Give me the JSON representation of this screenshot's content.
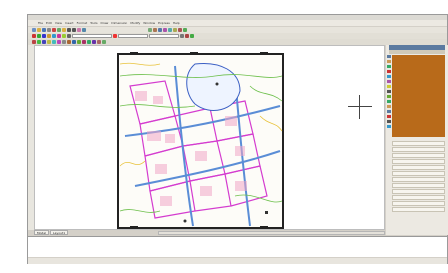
{
  "menu": {
    "items": [
      "File",
      "Edit",
      "View",
      "Insert",
      "Format",
      "Tools",
      "Draw",
      "Dimension",
      "Modify",
      "Window",
      "Express",
      "Help"
    ]
  },
  "status_panel": {
    "title": "",
    "header": "",
    "rows": [
      "",
      "",
      "",
      "",
      "",
      "",
      "",
      "",
      ""
    ]
  },
  "layer_list": [
    "",
    "",
    "",
    "",
    "",
    "",
    "",
    "",
    "",
    "",
    "",
    ""
  ],
  "tabs": [
    "Model",
    "Layout1"
  ],
  "command_lines": [
    "",
    "",
    ""
  ],
  "status_items": [
    "",
    "",
    "",
    "",
    "",
    "",
    "",
    "",
    "",
    ""
  ],
  "colors": {
    "accent_brown": "#b86a1a",
    "title_blue": "#5b7aa0"
  },
  "icons": [
    "crosshair-icon"
  ]
}
